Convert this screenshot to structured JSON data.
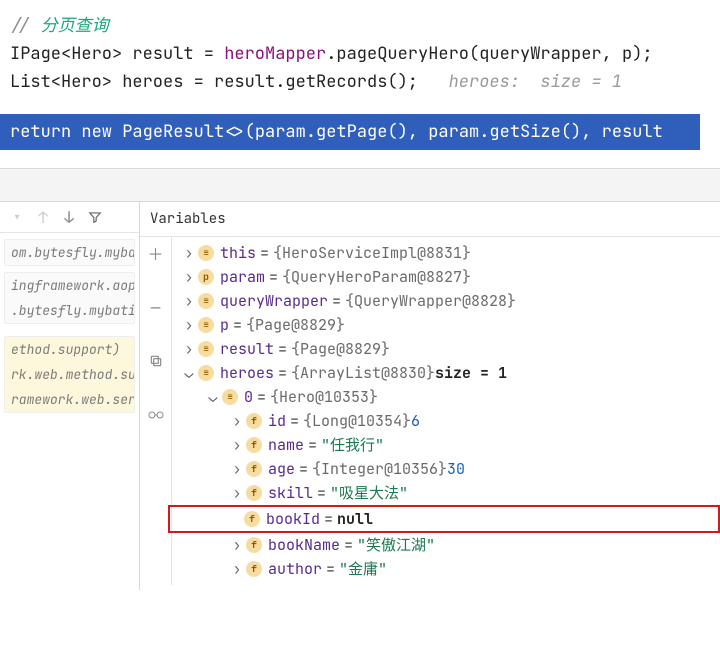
{
  "code": {
    "comment_slashes": "// ",
    "comment_text": "分页查询",
    "line2": {
      "t1": "IPage<Hero> result = ",
      "mapper": "heroMapper",
      "t2": ".pageQueryHero(queryWrapper, p);"
    },
    "line3": {
      "t1": "List<Hero> heroes = result.getRecords();   ",
      "hint": "heroes:  size = 1"
    },
    "ret": {
      "kw_return": "return ",
      "kw_new": "new ",
      "rest": "PageResult<>(param.getPage(), param.getSize(), result"
    }
  },
  "stack": {
    "g1": [
      "om.bytesfly.myba"
    ],
    "g2": [
      "ingframework.aop",
      ".bytesfly.mybati"
    ],
    "g3": [
      "ethod.support)",
      "rk.web.method.su",
      "ramework.web.ser"
    ]
  },
  "vars_title": "Variables",
  "tree": {
    "this": {
      "name": "this",
      "val": "{HeroServiceImpl@8831}"
    },
    "param": {
      "name": "param",
      "val": "{QueryHeroParam@8827}"
    },
    "queryWrapper": {
      "name": "queryWrapper",
      "val": "{QueryWrapper@8828}"
    },
    "p": {
      "name": "p",
      "val": "{Page@8829}"
    },
    "result": {
      "name": "result",
      "val": "{Page@8829}"
    },
    "heroes": {
      "name": "heroes",
      "val": "{ArrayList@8830}",
      "extra": "  size = 1"
    },
    "elem0": {
      "name": "0",
      "val": "{Hero@10353}"
    },
    "f_id": {
      "name": "id",
      "val": "{Long@10354}",
      "num": " 6"
    },
    "f_name": {
      "name": "name",
      "val": "\"任我行\""
    },
    "f_age": {
      "name": "age",
      "val": "{Integer@10356}",
      "num": " 30"
    },
    "f_skill": {
      "name": "skill",
      "val": "\"吸星大法\""
    },
    "f_bookId": {
      "name": "bookId",
      "val": "null"
    },
    "f_bookName": {
      "name": "bookName",
      "val": "\"笑傲江湖\""
    },
    "f_author": {
      "name": "author",
      "val": "\"金庸\""
    }
  }
}
